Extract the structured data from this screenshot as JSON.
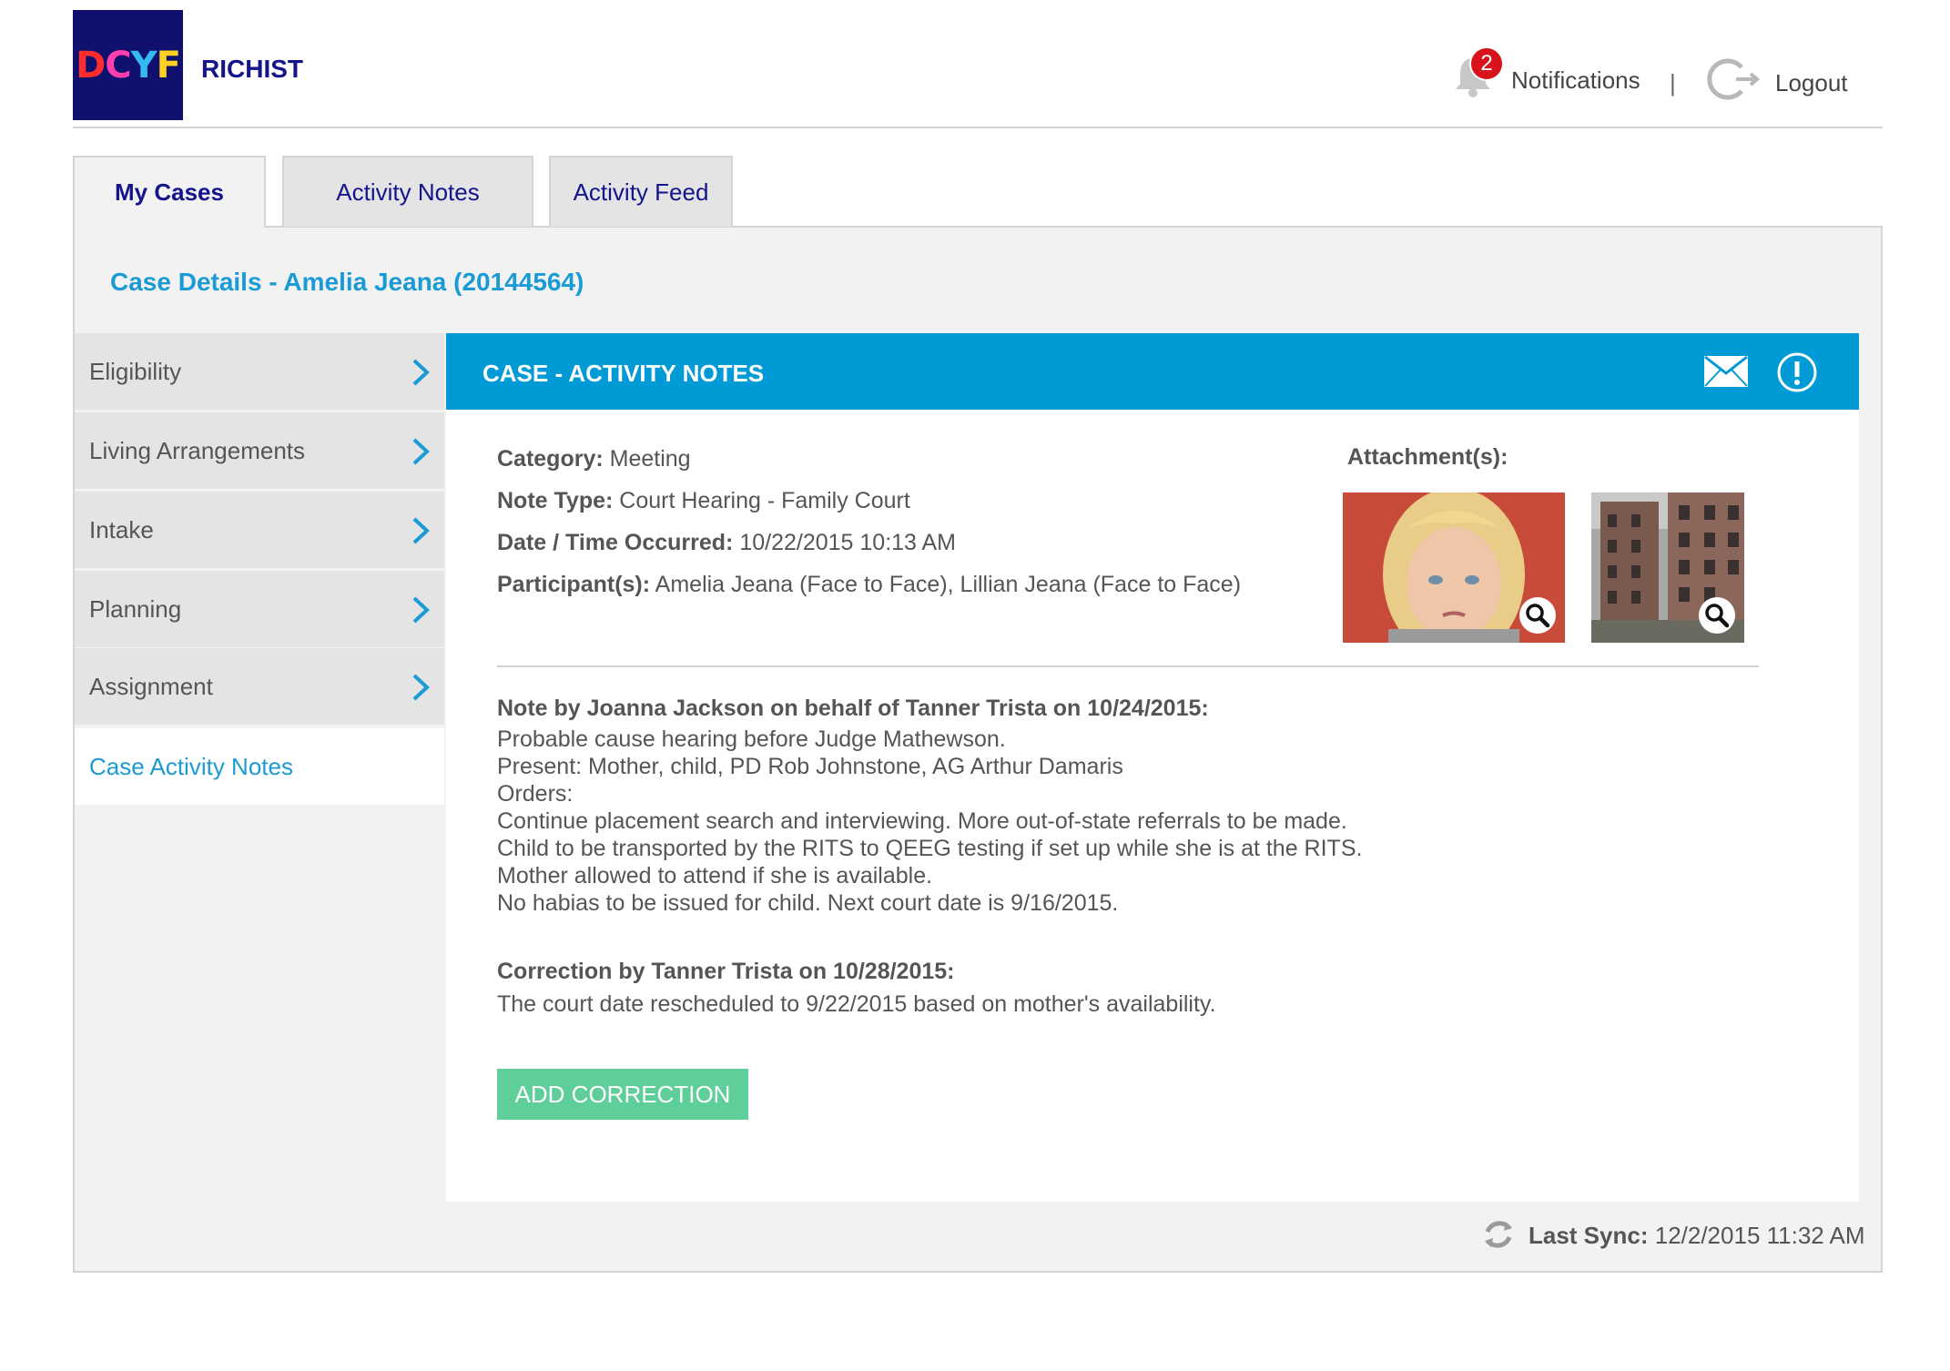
{
  "header": {
    "logo_letters": [
      "D",
      "C",
      "Y",
      "F"
    ],
    "logo_colors": [
      "#ff2d2d",
      "#ff3fae",
      "#35b9f0",
      "#ffd21f"
    ],
    "app_name": "RICHIST",
    "notifications_count": "2",
    "notifications_label": "Notifications",
    "separator": "|",
    "logout_label": "Logout"
  },
  "tabs": [
    {
      "label": "My Cases",
      "active": true
    },
    {
      "label": "Activity Notes",
      "active": false
    },
    {
      "label": "Activity Feed",
      "active": false
    }
  ],
  "case": {
    "title": "Case Details - Amelia Jeana (20144564)"
  },
  "sidebar": {
    "items": [
      {
        "label": "Eligibility"
      },
      {
        "label": "Living Arrangements"
      },
      {
        "label": "Intake"
      },
      {
        "label": "Planning"
      },
      {
        "label": "Assignment"
      },
      {
        "label": "Case Activity Notes",
        "active": true
      }
    ]
  },
  "panel": {
    "title": "CASE - ACTIVITY NOTES",
    "icons": [
      "mail-icon",
      "alert-icon"
    ],
    "fields": [
      {
        "label": "Category:",
        "value": "Meeting"
      },
      {
        "label": "Note Type:",
        "value": "Court Hearing - Family Court"
      },
      {
        "label": "Date / Time Occurred:",
        "value": "10/22/2015 10:13 AM"
      },
      {
        "label": "Participant(s):",
        "value": "Amelia Jeana (Face to Face), Lillian Jeana (Face to Face)"
      }
    ],
    "attachments_label": "Attachment(s):",
    "note": {
      "heading": "Note by Joanna Jackson on behalf of Tanner Trista on 10/24/2015:",
      "lines": [
        "Probable cause hearing before Judge Mathewson.",
        "Present: Mother, child, PD Rob Johnstone, AG Arthur Damaris",
        "Orders:",
        "Continue placement search and interviewing. More out-of-state referrals to be made.",
        "Child to be transported by the RITS to QEEG testing if set up while she is at the RITS.",
        "Mother allowed to attend if she is available.",
        "No habias to be issued for child. Next court date is 9/16/2015."
      ]
    },
    "correction": {
      "heading": "Correction by Tanner Trista on 10/28/2015:",
      "text": "The court date rescheduled to 9/22/2015 based on mother's availability."
    },
    "add_button": "ADD CORRECTION"
  },
  "footer": {
    "sync_label": "Last Sync:",
    "sync_value": "12/2/2015 11:32 AM"
  },
  "colors": {
    "accent": "#009ad6",
    "link": "#1b9bd5",
    "nav_text": "#14148c",
    "button": "#5fcf9a",
    "badge": "#d9131b"
  }
}
